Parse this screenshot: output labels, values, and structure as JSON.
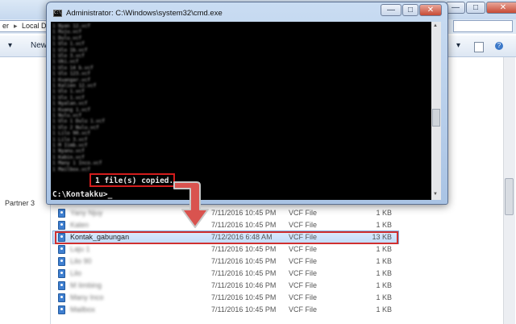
{
  "explorer": {
    "address": {
      "crumb_1": "er",
      "separator": "▸",
      "crumb_2": "Local Di"
    },
    "toolbar": {
      "organize_arrow": "▾",
      "new_folder_label": "New",
      "view_arrow": "▾"
    },
    "nav": {
      "partner_label": "Partner 3"
    },
    "files": [
      {
        "name": "Yany Njuy",
        "date": "7/11/2016 10:45 PM",
        "type": "VCF File",
        "size": "1 KB",
        "blurred": true
      },
      {
        "name": "Kalen",
        "date": "7/11/2016 10:45 PM",
        "type": "VCF File",
        "size": "1 KB",
        "blurred": true
      },
      {
        "name": "Kontak_gabungan",
        "date": "7/12/2016 6:48 AM",
        "type": "VCF File",
        "size": "13 KB",
        "blurred": false,
        "selected": true
      },
      {
        "name": "Laju 1",
        "date": "7/11/2016 10:45 PM",
        "type": "VCF File",
        "size": "1 KB",
        "blurred": true
      },
      {
        "name": "Lilo 90",
        "date": "7/11/2016 10:45 PM",
        "type": "VCF File",
        "size": "1 KB",
        "blurred": true
      },
      {
        "name": "Lilo",
        "date": "7/11/2016 10:45 PM",
        "type": "VCF File",
        "size": "1 KB",
        "blurred": true
      },
      {
        "name": "M Iimbing",
        "date": "7/11/2016 10:46 PM",
        "type": "VCF File",
        "size": "1 KB",
        "blurred": true
      },
      {
        "name": "Many Inco",
        "date": "7/11/2016 10:45 PM",
        "type": "VCF File",
        "size": "1 KB",
        "blurred": true
      },
      {
        "name": "Mailbox",
        "date": "7/11/2016 10:45 PM",
        "type": "VCF File",
        "size": "1 KB",
        "blurred": true
      }
    ]
  },
  "window_buttons": {
    "minimize": "—",
    "maximize": "□",
    "close": "✕"
  },
  "cmd": {
    "icon_text": "C:\\",
    "title": "Administrator: C:\\Windows\\system32\\cmd.exe",
    "blurred_lines": [
      "1 Nyan 12.vcf",
      "1 Ruju.vcf",
      "1 Dulu.vcf",
      "1 Ulo 1.vcf",
      "1 Ulo 1b.vcf",
      "1 Ulo 3.vcf",
      "1 Uki.vcf",
      "1 Ulo 14 b.vcf",
      "1 Ulo 123.vcf",
      "1 Kuangar.vcf",
      "1 Kalien 12.vcf",
      "1 Ulo 1.vcf",
      "1 Ulo 1.vcf",
      "1 Nyalan.vcf",
      "1 Kuang 1.vcf",
      "1 Nulu.vcf",
      "1 Ulo 1 Dulu 1.vcf",
      "1 Ulo 2 Nulu.vcf",
      "1 Lilo 90.vcf",
      "1 Lilo 3.vcf",
      "1 M Iimb.vcf",
      "1 Nyanu.vcf",
      "1 Kabin.vcf",
      "1 Many 1 Inco.vcf",
      "1 Mailbox.vcf"
    ],
    "copied_message": "1 file(s) copied.",
    "prompt": "C:\\Kontakku>_",
    "scroll_up": "▲",
    "scroll_down": "▼"
  }
}
